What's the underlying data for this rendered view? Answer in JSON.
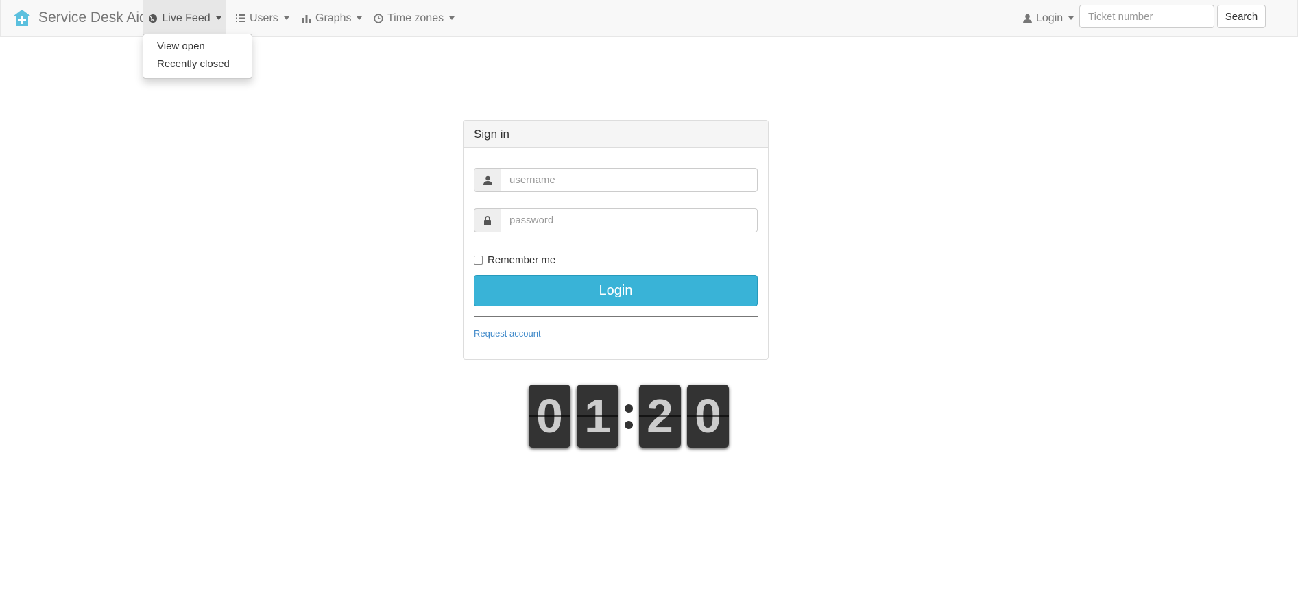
{
  "app": {
    "brand_name": "Service Desk Aid"
  },
  "nav": {
    "live_feed": "Live Feed",
    "users": "Users",
    "graphs": "Graphs",
    "time_zones": "Time zones",
    "login": "Login",
    "dropdown_items": [
      "View open",
      "Recently closed"
    ]
  },
  "search": {
    "placeholder": "Ticket number",
    "button": "Search"
  },
  "signin": {
    "title": "Sign in",
    "username_placeholder": "username",
    "password_placeholder": "password",
    "remember": "Remember me",
    "login_button": "Login",
    "request_account": "Request account"
  },
  "clock": {
    "digits": [
      "0",
      "1",
      "2",
      "0"
    ]
  },
  "colors": {
    "accent": "#39b3d7",
    "link": "#428bca",
    "brand_icon": "#5bc0de"
  }
}
